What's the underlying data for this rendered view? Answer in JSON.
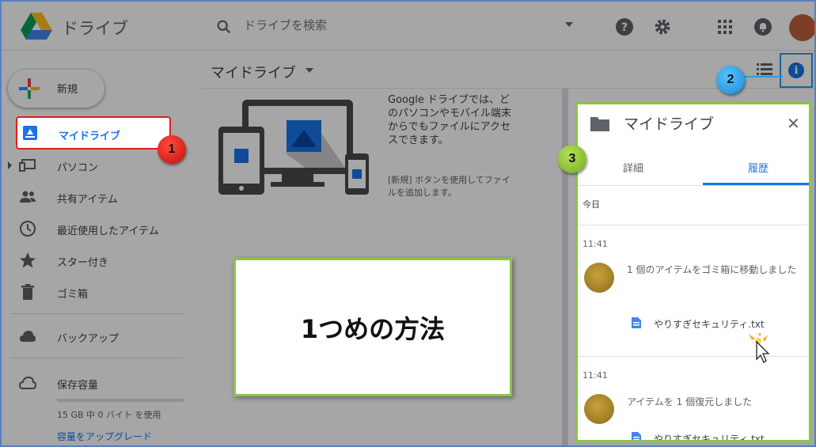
{
  "header": {
    "app_title": "ドライブ",
    "search_placeholder": "ドライブを検索",
    "icons": [
      "help-icon",
      "settings-icon",
      "apps-icon",
      "notifications-icon"
    ]
  },
  "sidebar": {
    "new_label": "新規",
    "items": [
      {
        "label": "マイドライブ",
        "icon": "my-drive-icon",
        "active": true
      },
      {
        "label": "パソコン",
        "icon": "computers-icon"
      },
      {
        "label": "共有アイテム",
        "icon": "shared-icon"
      },
      {
        "label": "最近使用したアイテム",
        "icon": "recent-icon"
      },
      {
        "label": "スター付き",
        "icon": "star-icon"
      },
      {
        "label": "ゴミ箱",
        "icon": "trash-icon"
      },
      {
        "label": "バックアップ",
        "icon": "backup-icon"
      },
      {
        "label": "保存容量",
        "icon": "storage-icon"
      }
    ],
    "storage_text": "15 GB 中 0 バイト を使用",
    "upgrade_label": "容量をアップグレード"
  },
  "main": {
    "title": "マイドライブ",
    "promo_text": "Google ドライブでは、どのパソコンやモバイル端末からでもファイルにアクセスできます。",
    "promo_sub": "[新規] ボタンを使用してファイルを追加します。"
  },
  "panel": {
    "title": "マイドライブ",
    "tabs": [
      "詳細",
      "履歴"
    ],
    "active_tab": "履歴",
    "date_label": "今日",
    "entries": [
      {
        "time": "11:41",
        "text": "1 個のアイテムをゴミ箱に移動しました",
        "file": "やりすぎセキュリティ.txt"
      },
      {
        "time": "11:41",
        "text": "アイテムを 1 個復元しました",
        "file": "やりすぎセキュリティ.txt"
      }
    ]
  },
  "callout": {
    "text": "1つめの方法"
  },
  "badges": [
    "1",
    "2",
    "3"
  ],
  "colors": {
    "accent": "#1a73e8",
    "badge1": "#e0201e",
    "badge2": "#2b9ae6",
    "badge3": "#8bc34a"
  }
}
